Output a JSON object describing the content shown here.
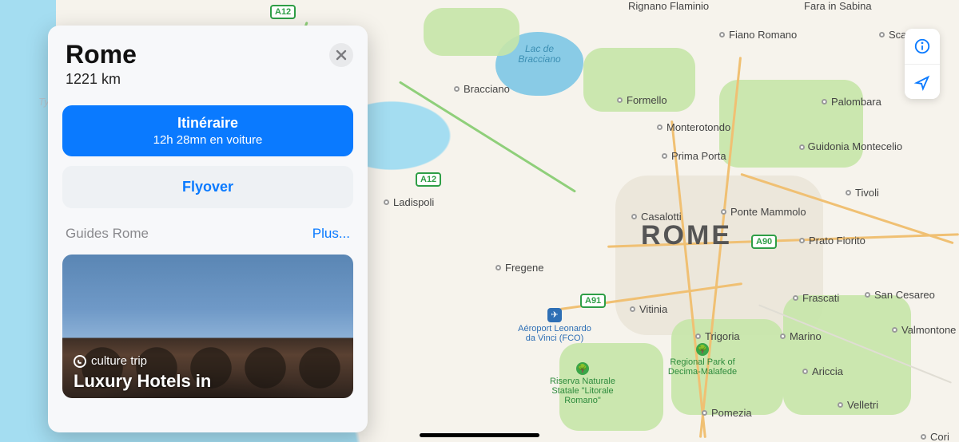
{
  "card": {
    "title": "Rome",
    "distance": "1221 km",
    "directions_label": "Itinéraire",
    "directions_eta": "12h 28mn en voiture",
    "flyover_label": "Flyover",
    "guides_section": "Guides Rome",
    "more_label": "Plus...",
    "guide": {
      "brand": "culture trip",
      "title": "Luxury Hotels in"
    }
  },
  "map": {
    "big_label": "ROME",
    "lake_label": "Lac de Bracciano",
    "cut_label": "Ty",
    "airport": "Aéroport Leonardo da Vinci (FCO)",
    "parks": [
      "Riserva Naturale Statale \"Litorale Romano\"",
      "Regional Park of Decima-Malafede"
    ],
    "shields": {
      "a12_top": "A12",
      "a12_mid": "A12",
      "a91": "A91",
      "a90": "A90"
    },
    "places": {
      "bracciano": "Bracciano",
      "formello": "Formello",
      "fiano": "Fiano Romano",
      "monterotondo": "Monterotondo",
      "prima_porta": "Prima Porta",
      "casalotti": "Casalotti",
      "ladispoli": "Ladispoli",
      "fregene": "Fregene",
      "vitinia": "Vitinia",
      "trigoria": "Trigoria",
      "pomezia": "Pomezia",
      "marino": "Marino",
      "frascati": "Frascati",
      "tivoli": "Tivoli",
      "guidonia": "Guidonia Montecelio",
      "ponte": "Ponte Mammolo",
      "prato": "Prato Fiorito",
      "palombara": "Palombara",
      "sancesareo": "San Cesareo",
      "valmontone": "Valmontone",
      "ariccia": "Ariccia",
      "velletri": "Velletri",
      "cori": "Cori",
      "sca": "Sca",
      "rignano": "Rignano Flaminio",
      "fara": "Fara in Sabina"
    }
  }
}
